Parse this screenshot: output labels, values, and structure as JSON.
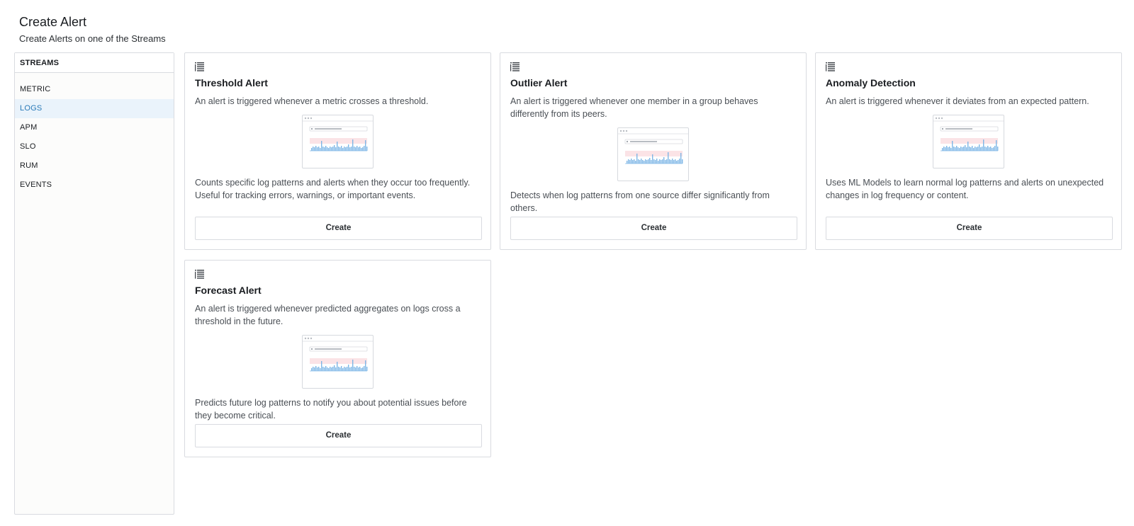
{
  "header": {
    "title": "Create Alert",
    "subtitle": "Create Alerts on one of the Streams"
  },
  "sidebar": {
    "heading": "STREAMS",
    "items": [
      {
        "label": "METRIC",
        "active": false
      },
      {
        "label": "LOGS",
        "active": true
      },
      {
        "label": "APM",
        "active": false
      },
      {
        "label": "SLO",
        "active": false
      },
      {
        "label": "RUM",
        "active": false
      },
      {
        "label": "EVENTS",
        "active": false
      }
    ]
  },
  "cards": [
    {
      "icon": "list-icon",
      "title": "Threshold Alert",
      "description": "An alert is triggered whenever a metric crosses a threshold.",
      "detail": "Counts specific log patterns and alerts when they occur too frequently. Useful for tracking errors, warnings, or important events.",
      "button": "Create"
    },
    {
      "icon": "list-icon",
      "title": "Outlier Alert",
      "description": "An alert is triggered whenever one member in a group behaves differently from its peers.",
      "detail": "Detects when log patterns from one source differ significantly from others.",
      "button": "Create"
    },
    {
      "icon": "list-icon",
      "title": "Anomaly Detection",
      "description": "An alert is triggered whenever it deviates from an expected pattern.",
      "detail": "Uses ML Models to learn normal log patterns and alerts on unexpected changes in log frequency or content.",
      "button": "Create"
    },
    {
      "icon": "list-icon",
      "title": "Forecast Alert",
      "description": "An alert is triggered whenever predicted aggregates on logs cross a threshold in the future.",
      "detail": "Predicts future log patterns to notify you about potential issues before they become critical.",
      "button": "Create"
    }
  ],
  "colors": {
    "active_item_bg": "#eaf3fb",
    "active_item_text": "#2a7ab8",
    "chart_bars": "#7eb6e6",
    "chart_band": "#fbe3e6"
  }
}
